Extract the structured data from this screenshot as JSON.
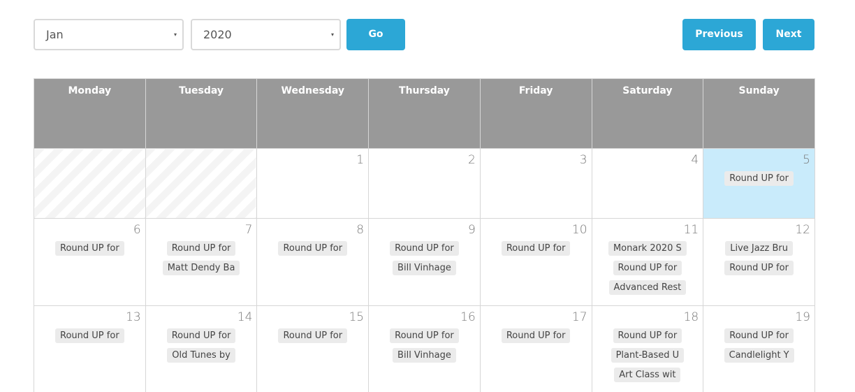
{
  "toolbar": {
    "month_select": "Jan",
    "year_select": "2020",
    "go_label": "Go",
    "previous_label": "Previous",
    "next_label": "Next",
    "caret_icon": "▾"
  },
  "colors": {
    "accent": "#2ca7d6",
    "header_bg": "#999999",
    "today_bg": "#c9ebfb",
    "event_bg": "#ebebeb"
  },
  "calendar": {
    "weekdays": [
      "Monday",
      "Tuesday",
      "Wednesday",
      "Thursday",
      "Friday",
      "Saturday",
      "Sunday"
    ],
    "weeks": [
      [
        {
          "day": "",
          "empty": true,
          "events": []
        },
        {
          "day": "",
          "empty": true,
          "events": []
        },
        {
          "day": "1",
          "events": []
        },
        {
          "day": "2",
          "events": []
        },
        {
          "day": "3",
          "events": []
        },
        {
          "day": "4",
          "events": []
        },
        {
          "day": "5",
          "today": true,
          "events": [
            "Round UP for"
          ]
        }
      ],
      [
        {
          "day": "6",
          "events": [
            "Round UP for"
          ]
        },
        {
          "day": "7",
          "events": [
            "Round UP for",
            "Matt Dendy Ba"
          ]
        },
        {
          "day": "8",
          "events": [
            "Round UP for"
          ]
        },
        {
          "day": "9",
          "events": [
            "Round UP for",
            "Bill Vinhage"
          ]
        },
        {
          "day": "10",
          "events": [
            "Round UP for"
          ]
        },
        {
          "day": "11",
          "events": [
            "Monark 2020 S",
            "Round UP for",
            "Advanced Rest"
          ]
        },
        {
          "day": "12",
          "events": [
            "Live Jazz Bru",
            "Round UP for"
          ]
        }
      ],
      [
        {
          "day": "13",
          "events": [
            "Round UP for"
          ]
        },
        {
          "day": "14",
          "events": [
            "Round UP for",
            "Old Tunes by"
          ]
        },
        {
          "day": "15",
          "events": [
            "Round UP for"
          ]
        },
        {
          "day": "16",
          "events": [
            "Round UP for",
            "Bill Vinhage"
          ]
        },
        {
          "day": "17",
          "events": [
            "Round UP for"
          ]
        },
        {
          "day": "18",
          "events": [
            "Round UP for",
            "Plant-Based U",
            "Art Class wit"
          ]
        },
        {
          "day": "19",
          "events": [
            "Round UP for",
            "Candlelight Y"
          ]
        }
      ]
    ]
  }
}
